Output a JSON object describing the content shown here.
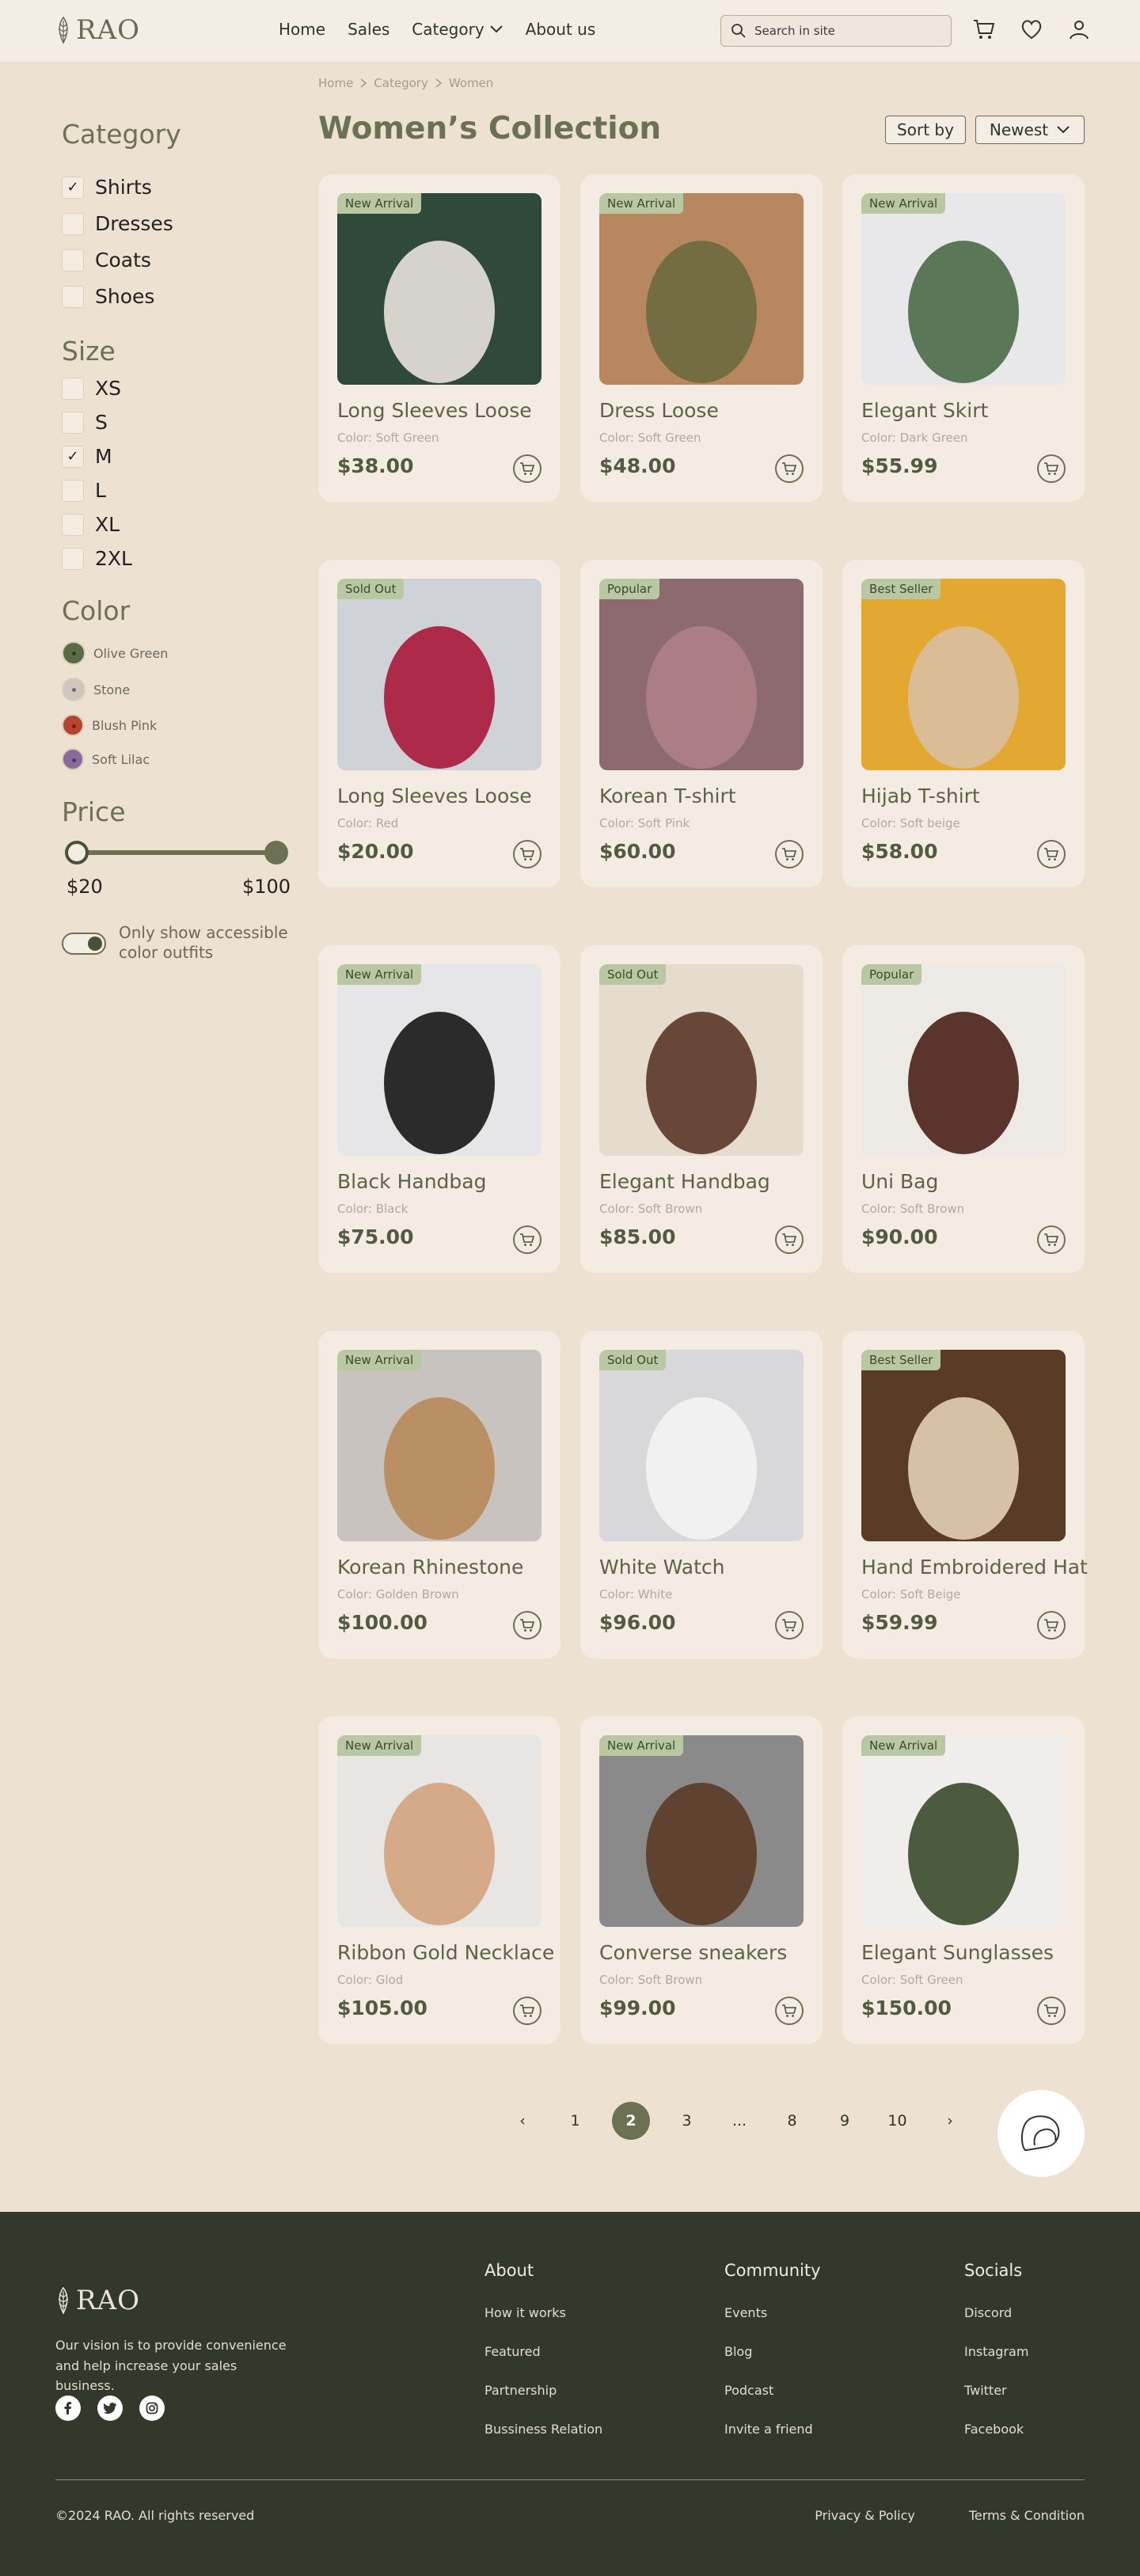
{
  "header": {
    "logo": "RAO",
    "nav": [
      "Home",
      "Sales",
      "Category",
      "About us"
    ],
    "search_placeholder": "Search in site"
  },
  "breadcrumb": [
    "Home",
    "Category",
    "Women"
  ],
  "sidebar": {
    "category_title": "Category",
    "categories": [
      {
        "label": "Shirts",
        "checked": true
      },
      {
        "label": "Dresses",
        "checked": false
      },
      {
        "label": "Coats",
        "checked": false
      },
      {
        "label": "Shoes",
        "checked": false
      }
    ],
    "size_title": "Size",
    "sizes": [
      {
        "label": "XS",
        "checked": false
      },
      {
        "label": "S",
        "checked": false
      },
      {
        "label": "M",
        "checked": true
      },
      {
        "label": "L",
        "checked": false
      },
      {
        "label": "XL",
        "checked": false
      },
      {
        "label": "2XL",
        "checked": false
      }
    ],
    "color_title": "Color",
    "colors": [
      {
        "label": "Olive Green",
        "hex": "#5a6a45"
      },
      {
        "label": "Stone",
        "hex": "#cfc7bd"
      },
      {
        "label": "Blush Pink",
        "hex": "#b8432e"
      },
      {
        "label": "Soft Lilac",
        "hex": "#8a6a9a"
      }
    ],
    "price_title": "Price",
    "price_min": "$20",
    "price_max": "$100",
    "toggle_label": "Only show accessible color outfits",
    "toggle_on": true
  },
  "main": {
    "title": "Women’s Collection",
    "sort_label": "Sort by",
    "sort_value": "Newest"
  },
  "products": [
    {
      "badge": "New Arrival",
      "name": "Long Sleeves Loose",
      "color": "Color: Soft Green",
      "price": "$38.00",
      "bg": "#2f4a3a",
      "accent": "#e8e2dc"
    },
    {
      "badge": "New Arrival",
      "name": "Dress Loose",
      "color": "Color: Soft Green",
      "price": "$48.00",
      "bg": "#b8875f",
      "accent": "#6d6a40"
    },
    {
      "badge": "New Arrival",
      "name": "Elegant Skirt",
      "color": "Color: Dark Green",
      "price": "$55.99",
      "bg": "#e8e8ea",
      "accent": "#4a6a48"
    },
    {
      "badge": "Sold Out",
      "name": "Long Sleeves Loose",
      "color": "Color: Red",
      "price": "$20.00",
      "bg": "#cfd3d8",
      "accent": "#a8183a"
    },
    {
      "badge": "Popular",
      "name": "Korean T-shirt",
      "color": "Color: Soft Pink",
      "price": "$60.00",
      "bg": "#8d6a6f",
      "accent": "#b08088"
    },
    {
      "badge": "Best Seller",
      "name": "Hijab T-shirt",
      "color": "Color: Soft beige",
      "price": "$58.00",
      "bg": "#e3a832",
      "accent": "#d9bfa0"
    },
    {
      "badge": "New Arrival",
      "name": "Black Handbag",
      "color": "Color: Black",
      "price": "$75.00",
      "bg": "#e6e6e8",
      "accent": "#161616"
    },
    {
      "badge": "Sold Out",
      "name": "Elegant Handbag",
      "color": "Color: Soft Brown",
      "price": "$85.00",
      "bg": "#e6dccd",
      "accent": "#5a3628"
    },
    {
      "badge": "Popular",
      "name": "Uni Bag",
      "color": "Color: Soft Brown",
      "price": "$90.00",
      "bg": "#ede9e4",
      "accent": "#4a2018"
    },
    {
      "badge": "New Arrival",
      "name": "Korean Rhinestone",
      "color": "Color: Golden Brown",
      "price": "$100.00",
      "bg": "#c9c3c0",
      "accent": "#b88a5a"
    },
    {
      "badge": "Sold Out",
      "name": "White Watch",
      "color": "Color: White",
      "price": "$96.00",
      "bg": "#d8d8da",
      "accent": "#f4f4f4"
    },
    {
      "badge": "Best Seller",
      "name": "Hand Embroidered Hat",
      "color": "Color: Soft Beige",
      "price": "$59.99",
      "bg": "#5a3b26",
      "accent": "#e3d0b5"
    },
    {
      "badge": "New Arrival",
      "name": "Ribbon Gold Necklace",
      "color": "Color: Glod",
      "price": "$105.00",
      "bg": "#e8e6e4",
      "accent": "#d4a27e"
    },
    {
      "badge": "New Arrival",
      "name": "Converse sneakers",
      "color": "Color: Soft Brown",
      "price": "$99.00",
      "bg": "#8a8a8a",
      "accent": "#5b3a26"
    },
    {
      "badge": "New Arrival",
      "name": "Elegant Sunglasses",
      "color": "Color: Soft Green",
      "price": "$150.00",
      "bg": "#f0eeec",
      "accent": "#3a4a2a"
    }
  ],
  "pagination": {
    "prev": "‹",
    "pages": [
      "1",
      "2",
      "3",
      "...",
      "8",
      "9",
      "10"
    ],
    "active": "2",
    "next": "›"
  },
  "footer": {
    "logo": "RAO",
    "vision": "Our vision is to provide convenience and help increase your sales business.",
    "columns": [
      {
        "title": "About",
        "links": [
          "How it works",
          "Featured",
          "Partnership",
          "Bussiness Relation"
        ]
      },
      {
        "title": "Community",
        "links": [
          "Events",
          "Blog",
          "Podcast",
          "Invite a friend"
        ]
      },
      {
        "title": "Socials",
        "links": [
          "Discord",
          "Instagram",
          "Twitter",
          "Facebook"
        ]
      }
    ],
    "copyright": "©2024 RAO. All rights reserved",
    "bottom_links": [
      "Privacy & Policy",
      "Terms & Condition"
    ]
  }
}
